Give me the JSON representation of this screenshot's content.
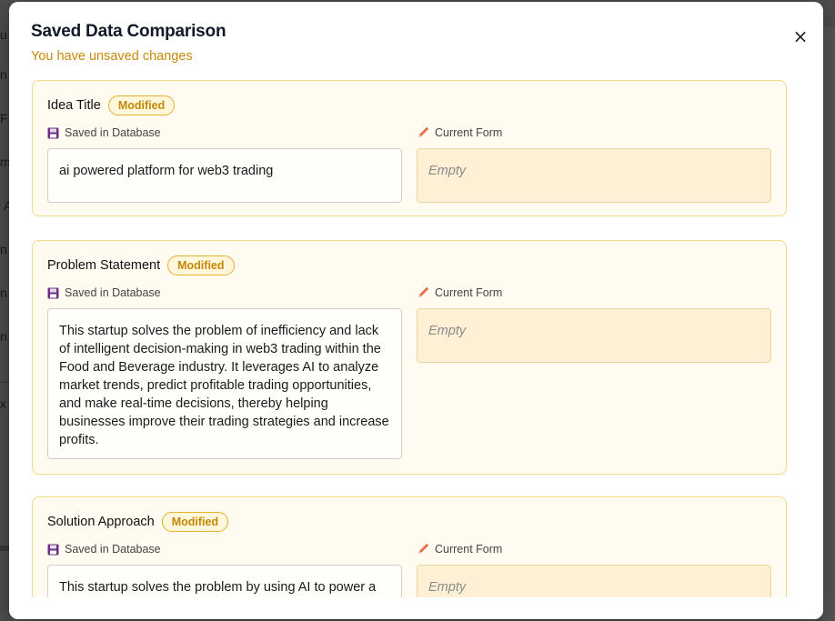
{
  "modal": {
    "title": "Saved Data Comparison",
    "subtitle": "You have unsaved changes",
    "close_label": "×"
  },
  "labels": {
    "saved": "Saved in Database",
    "current": "Current Form",
    "badge": "Modified"
  },
  "fields": [
    {
      "label": "Idea Title",
      "saved_value": "ai powered platform for web3 trading",
      "current_value": "Empty"
    },
    {
      "label": "Problem Statement",
      "saved_value": "This startup solves the problem of inefficiency and lack of intelligent decision-making in web3 trading within the Food and Beverage industry. It leverages AI to analyze market trends, predict profitable trading opportunities, and make real-time decisions, thereby helping businesses improve their trading strategies and increase profits.",
      "current_value": "Empty"
    },
    {
      "label": "Solution Approach",
      "saved_value": "This startup solves the problem by using AI to power a",
      "current_value": "Empty"
    }
  ],
  "colors": {
    "accent": "#c98a0a",
    "card_bg": "#fffbf0",
    "card_border": "#f2d98a",
    "current_bg": "#fdf0d5"
  },
  "icons": {
    "saved": "floppy-disk-icon",
    "current": "pencil-icon",
    "close": "close-icon"
  }
}
